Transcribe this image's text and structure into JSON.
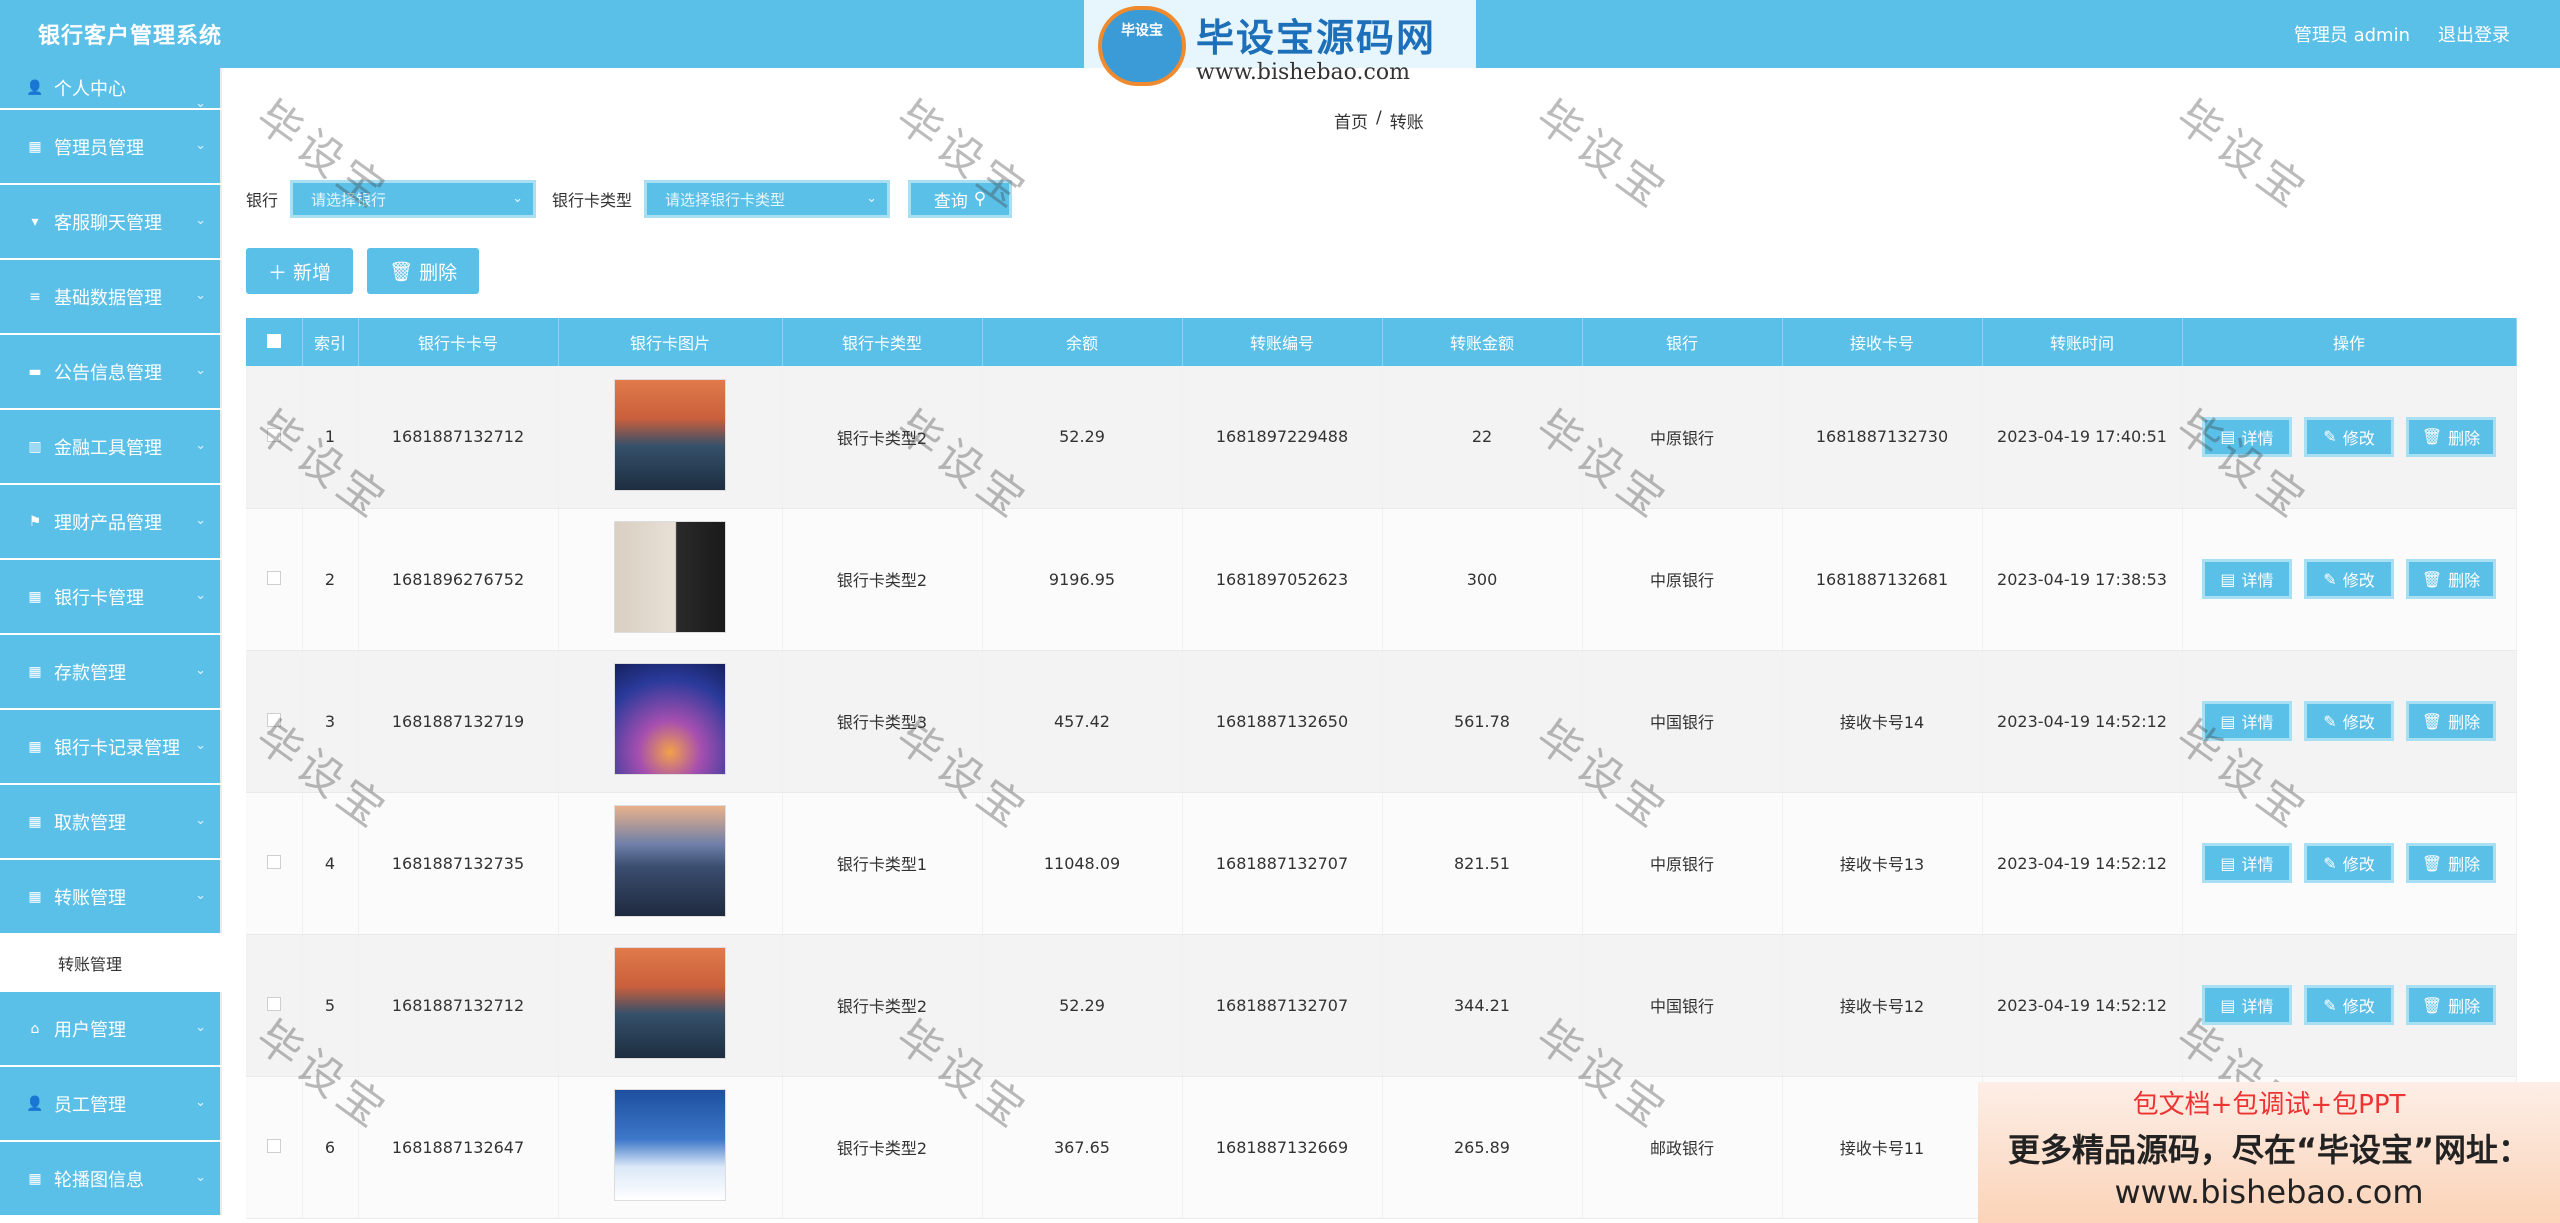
{
  "app": {
    "title": "银行客户管理系统",
    "admin_label": "管理员 admin",
    "logout_label": "退出登录"
  },
  "logo": {
    "badge": "毕设宝",
    "name": "毕设宝源码网",
    "url": "www.bishebao.com"
  },
  "sidebar": {
    "items": [
      {
        "label": "个人中心",
        "icon": "user-icon"
      },
      {
        "label": "管理员管理",
        "icon": "grid-icon"
      },
      {
        "label": "客服聊天管理",
        "icon": "chat-icon"
      },
      {
        "label": "基础数据管理",
        "icon": "list-icon"
      },
      {
        "label": "公告信息管理",
        "icon": "message-icon"
      },
      {
        "label": "金融工具管理",
        "icon": "chart-icon"
      },
      {
        "label": "理财产品管理",
        "icon": "flag-icon"
      },
      {
        "label": "银行卡管理",
        "icon": "grid-icon"
      },
      {
        "label": "存款管理",
        "icon": "grid-icon"
      },
      {
        "label": "银行卡记录管理",
        "icon": "grid-icon"
      },
      {
        "label": "取款管理",
        "icon": "grid-icon"
      },
      {
        "label": "转账管理",
        "icon": "grid-icon"
      }
    ],
    "submenu_label": "转账管理",
    "items_after": [
      {
        "label": "用户管理",
        "icon": "bank-icon"
      },
      {
        "label": "员工管理",
        "icon": "user-icon"
      },
      {
        "label": "轮播图信息",
        "icon": "grid-icon"
      }
    ]
  },
  "breadcrumb": {
    "home": "首页",
    "sep": "/",
    "current": "转账"
  },
  "filters": {
    "bank_label": "银行",
    "bank_placeholder": "请选择银行",
    "card_type_label": "银行卡类型",
    "card_type_placeholder": "请选择银行卡类型",
    "query_label": "查询"
  },
  "actions": {
    "add_label": "新增",
    "delete_label": "删除"
  },
  "table": {
    "headers": [
      "索引",
      "银行卡卡号",
      "银行卡图片",
      "银行卡类型",
      "余额",
      "转账编号",
      "转账金额",
      "银行",
      "接收卡号",
      "转账时间",
      "操作"
    ],
    "row_buttons": {
      "detail": "详情",
      "edit": "修改",
      "delete": "删除"
    },
    "rows": [
      {
        "index": "1",
        "card_no": "1681887132712",
        "card_type": "银行卡类型2",
        "balance": "52.29",
        "transfer_no": "1681897229488",
        "amount": "22",
        "bank": "中原银行",
        "receiver": "1681887132730",
        "time": "2023-04-19 17:40:51",
        "image": "lake-sunset-image"
      },
      {
        "index": "2",
        "card_no": "1681896276752",
        "card_type": "银行卡类型2",
        "balance": "9196.95",
        "transfer_no": "1681897052623",
        "amount": "300",
        "bank": "中原银行",
        "receiver": "1681887132681",
        "time": "2023-04-19 17:38:53",
        "image": "gallery-person-image"
      },
      {
        "index": "3",
        "card_no": "1681887132719",
        "card_type": "银行卡类型3",
        "balance": "457.42",
        "transfer_no": "1681887132650",
        "amount": "561.78",
        "bank": "中国银行",
        "receiver": "接收卡号14",
        "time": "2023-04-19 14:52:12",
        "image": "eiffel-tower-image"
      },
      {
        "index": "4",
        "card_no": "1681887132735",
        "card_type": "银行卡类型1",
        "balance": "11048.09",
        "transfer_no": "1681887132707",
        "amount": "821.51",
        "bank": "中原银行",
        "receiver": "接收卡号13",
        "time": "2023-04-19 14:52:12",
        "image": "mount-fuji-city-image"
      },
      {
        "index": "5",
        "card_no": "1681887132712",
        "card_type": "银行卡类型2",
        "balance": "52.29",
        "transfer_no": "1681887132707",
        "amount": "344.21",
        "bank": "中国银行",
        "receiver": "接收卡号12",
        "time": "2023-04-19 14:52:12",
        "image": "lake-sunset-image"
      },
      {
        "index": "6",
        "card_no": "1681887132647",
        "card_type": "银行卡类型2",
        "balance": "367.65",
        "transfer_no": "1681887132669",
        "amount": "265.89",
        "bank": "邮政银行",
        "receiver": "接收卡号11",
        "time": "",
        "image": "snow-house-image"
      }
    ]
  },
  "watermark": "毕设宝",
  "ad": {
    "line1": "包文档+包调试+包PPT",
    "line2": "更多精品源码，尽在“毕设宝”网址：",
    "line3": "www.bishebao.com"
  },
  "colors": {
    "primary": "#5bc0e8",
    "white": "#ffffff",
    "ad_red": "#ee3333"
  }
}
